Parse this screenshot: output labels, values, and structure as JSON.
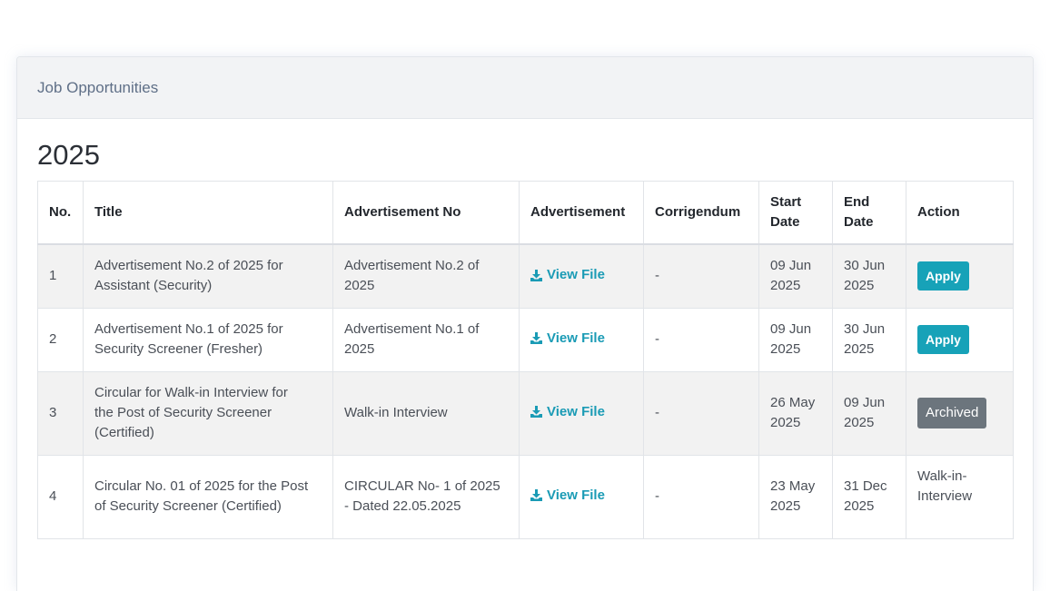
{
  "card": {
    "title": "Job Opportunities"
  },
  "section": {
    "year": "2025"
  },
  "table": {
    "headers": {
      "no": "No.",
      "title": "Title",
      "adv_no": "Advertisement No",
      "advertisement": "Advertisement",
      "corrigendum": "Corrigendum",
      "start_date": [
        "Start",
        "Date"
      ],
      "end_date": [
        "End",
        "Date"
      ],
      "action": "Action"
    },
    "rows": [
      {
        "no": "1",
        "title": [
          "Advertisement No.2 of 2025 for",
          "Assistant (Security)"
        ],
        "adv_no": [
          "Advertisement No.2 of",
          "2025"
        ],
        "advertisement": "View File",
        "corrigendum": "-",
        "start_date": [
          "09 Jun",
          "2025"
        ],
        "end_date": [
          "30 Jun",
          "2025"
        ],
        "action": "Apply"
      },
      {
        "no": "2",
        "title": [
          "Advertisement No.1 of 2025 for",
          "Security Screener (Fresher)"
        ],
        "adv_no": [
          "Advertisement No.1 of",
          "2025"
        ],
        "advertisement": "View File",
        "corrigendum": "-",
        "start_date": [
          "09 Jun",
          "2025"
        ],
        "end_date": [
          "30 Jun",
          "2025"
        ],
        "action": "Apply"
      },
      {
        "no": "3",
        "title": [
          "Circular for Walk-in Interview for",
          "the Post of Security Screener",
          "(Certified)"
        ],
        "adv_no": [
          "Walk-in Interview"
        ],
        "advertisement": "View File",
        "corrigendum": "-",
        "start_date": [
          "26 May",
          "2025"
        ],
        "end_date": [
          "09 Jun",
          "2025"
        ],
        "action": "Archived"
      },
      {
        "no": "4",
        "title": [
          "Circular No. 01 of 2025 for the Post",
          "of Security Screener (Certified)"
        ],
        "adv_no": [
          "CIRCULAR No- 1 of 2025",
          "- Dated 22.05.2025"
        ],
        "advertisement": "View File",
        "corrigendum": "-",
        "start_date": [
          "23 May",
          "2025"
        ],
        "end_date": [
          "31 Dec",
          "2025"
        ],
        "action": [
          "Walk-in-",
          "Interview"
        ]
      }
    ]
  },
  "icons": {
    "view_file": "download-icon"
  },
  "colors": {
    "link": "#1a9bb5",
    "apply": "#17a2b8",
    "archived": "#6c757d"
  }
}
